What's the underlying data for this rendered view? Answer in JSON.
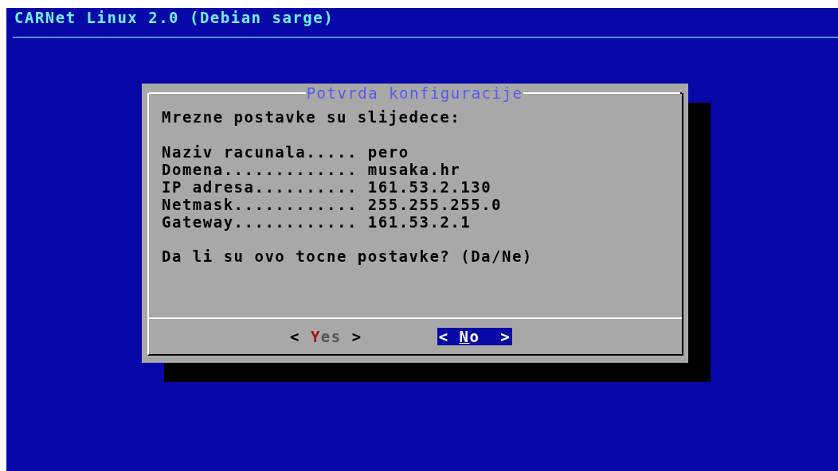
{
  "header": {
    "title": "CARNet Linux 2.0 (Debian sarge)"
  },
  "dialog": {
    "title": "Potvrda konfiguracije",
    "intro": "Mrezne postavke su slijedece:",
    "fields": [
      {
        "label": "Naziv racunala.....",
        "value": "pero"
      },
      {
        "label": "Domena.............",
        "value": "musaka.hr"
      },
      {
        "label": "IP adresa..........",
        "value": "161.53.2.130"
      },
      {
        "label": "Netmask............",
        "value": "255.255.255.0"
      },
      {
        "label": "Gateway............",
        "value": "161.53.2.1"
      }
    ],
    "question": "Da li su ovo tocne postavke? (Da/Ne)",
    "buttons": [
      {
        "open": "<",
        "label": "Yes",
        "close": ">",
        "selected": false
      },
      {
        "open": "<",
        "label": "No",
        "close": ">",
        "selected": true
      }
    ]
  }
}
